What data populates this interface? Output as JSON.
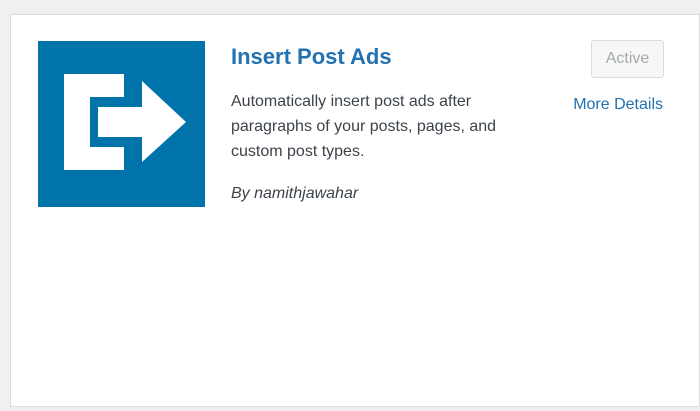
{
  "plugin": {
    "name": "Insert Post Ads",
    "description": "Automatically insert post ads after paragraphs of your posts, pages, and custom post types.",
    "author_prefix": "By",
    "author": "namithjawahar",
    "icon": "insert-arrow-icon",
    "status_label": "Active",
    "details_label": "More Details"
  },
  "colors": {
    "icon_background": "#0073aa",
    "link": "#2271b1",
    "text": "#3c434a",
    "disabled_button_text": "#a7aaad"
  }
}
